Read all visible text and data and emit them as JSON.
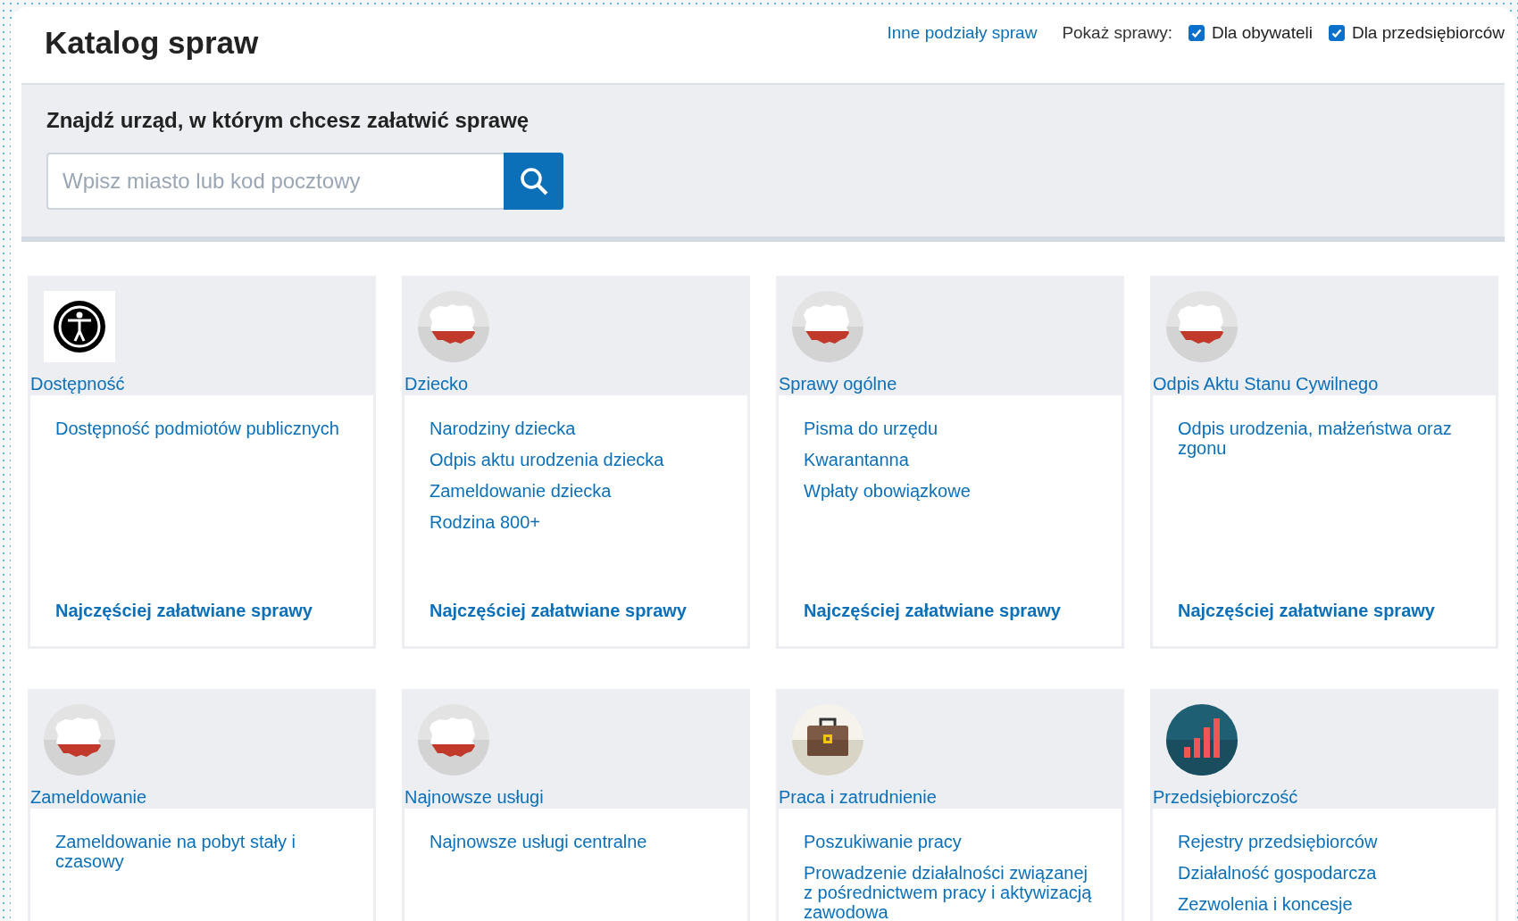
{
  "header": {
    "title": "Katalog spraw",
    "other_link": "Inne podziały spraw",
    "filter_label": "Pokaż sprawy:",
    "filters": [
      {
        "label": "Dla obywateli",
        "checked": true
      },
      {
        "label": "Dla przedsiębiorców",
        "checked": true
      }
    ]
  },
  "search": {
    "heading": "Znajdź urząd, w którym chcesz załatwić sprawę",
    "placeholder": "Wpisz miasto lub kod pocztowy"
  },
  "categories": [
    {
      "kind": "accessibility",
      "title": "Dostępność",
      "links": [
        "Dostępność podmiotów publicznych"
      ],
      "footer": "Najczęściej załatwiane sprawy"
    },
    {
      "kind": "poland",
      "title": "Dziecko",
      "links": [
        "Narodziny dziecka",
        "Odpis aktu urodzenia dziecka",
        "Zameldowanie dziecka",
        "Rodzina 800+"
      ],
      "footer": "Najczęściej załatwiane sprawy"
    },
    {
      "kind": "poland",
      "title": "Sprawy ogólne",
      "links": [
        "Pisma do urzędu",
        "Kwarantanna",
        "Wpłaty obowiązkowe"
      ],
      "footer": "Najczęściej załatwiane sprawy"
    },
    {
      "kind": "poland",
      "title": "Odpis Aktu Stanu Cywilnego",
      "links": [
        "Odpis urodzenia, małżeństwa oraz zgonu"
      ],
      "footer": "Najczęściej załatwiane sprawy"
    },
    {
      "kind": "poland",
      "title": "Zameldowanie",
      "links": [
        "Zameldowanie na pobyt stały i czasowy"
      ]
    },
    {
      "kind": "poland",
      "title": "Najnowsze usługi",
      "links": [
        "Najnowsze usługi centralne"
      ]
    },
    {
      "kind": "briefcase",
      "title": "Praca i zatrudnienie",
      "links": [
        "Poszukiwanie pracy",
        "Prowadzenie działalności związanej z pośrednictwem pracy i aktywizacją zawodowa"
      ]
    },
    {
      "kind": "chart",
      "title": "Przedsiębiorczość",
      "links": [
        "Rejestry przedsiębiorców",
        "Działalność gospodarcza",
        "Zezwolenia i koncesje"
      ]
    }
  ]
}
